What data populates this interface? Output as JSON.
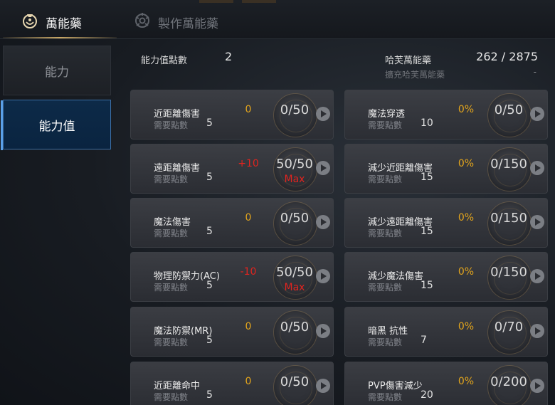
{
  "tabs": {
    "active_label": "萬能藥",
    "inactive_label": "製作萬能藥"
  },
  "sidebar": {
    "items": [
      {
        "label": "能力"
      },
      {
        "label": "能力值"
      }
    ]
  },
  "summary": {
    "points_label": "能力值點數",
    "points_value": "2",
    "elixir_label": "哈芙萬能藥",
    "elixir_value": "262 / 2875",
    "expand_label": "擴充哈芙萬能藥",
    "expand_value": "-"
  },
  "cards_left": [
    {
      "name": "近距離傷害",
      "req_label": "需要點數",
      "cost": "5",
      "bonus": "0",
      "bonus_type": "zero",
      "level": "0/50",
      "max": ""
    },
    {
      "name": "遠距離傷害",
      "req_label": "需要點數",
      "cost": "5",
      "bonus": "+10",
      "bonus_type": "neg",
      "level": "50/50",
      "max": "Max"
    },
    {
      "name": "魔法傷害",
      "req_label": "需要點數",
      "cost": "5",
      "bonus": "0",
      "bonus_type": "zero",
      "level": "0/50",
      "max": ""
    },
    {
      "name": "物理防禦力(AC)",
      "req_label": "需要點數",
      "cost": "5",
      "bonus": "-10",
      "bonus_type": "neg",
      "level": "50/50",
      "max": "Max"
    },
    {
      "name": "魔法防禦(MR)",
      "req_label": "需要點數",
      "cost": "5",
      "bonus": "0",
      "bonus_type": "zero",
      "level": "0/50",
      "max": ""
    },
    {
      "name": "近距離命中",
      "req_label": "需要點數",
      "cost": "5",
      "bonus": "0",
      "bonus_type": "zero",
      "level": "0/50",
      "max": ""
    }
  ],
  "cards_right": [
    {
      "name": "魔法穿透",
      "req_label": "需要點數",
      "cost": "10",
      "bonus": "0%",
      "bonus_type": "zero",
      "level": "0/50"
    },
    {
      "name": "減少近距離傷害",
      "req_label": "需要點數",
      "cost": "15",
      "bonus": "0%",
      "bonus_type": "zero",
      "level": "0/150"
    },
    {
      "name": "減少遠距離傷害",
      "req_label": "需要點數",
      "cost": "15",
      "bonus": "0%",
      "bonus_type": "zero",
      "level": "0/150"
    },
    {
      "name": "減少魔法傷害",
      "req_label": "需要點數",
      "cost": "15",
      "bonus": "0%",
      "bonus_type": "zero",
      "level": "0/150"
    },
    {
      "name": "暗黑 抗性",
      "req_label": "需要點數",
      "cost": "7",
      "bonus": "0%",
      "bonus_type": "zero",
      "level": "0/70"
    },
    {
      "name": "PVP傷害減少",
      "req_label": "需要點數",
      "cost": "20",
      "bonus": "0%",
      "bonus_type": "zero",
      "level": "0/200"
    }
  ],
  "colors": {
    "accent_gold": "#c9a866",
    "active_blue": "#0d2a48",
    "bonus_orange": "#e3a51c",
    "max_red": "#e0241f"
  },
  "icons": {
    "active_tab_icon": "elixir-flask-icon",
    "inactive_tab_icon": "crafting-gear-icon",
    "card_action_icon": "play-arrow-icon"
  }
}
